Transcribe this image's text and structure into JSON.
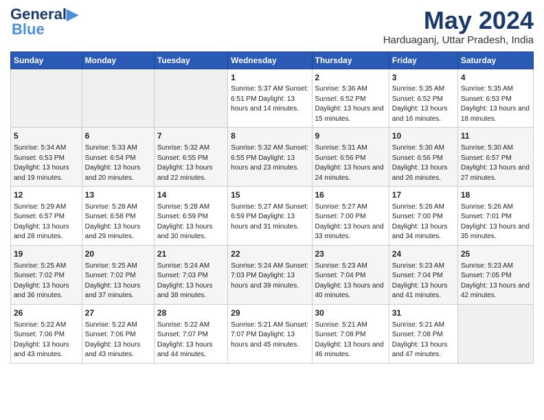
{
  "header": {
    "logo_line1": "General",
    "logo_line2": "Blue",
    "month_title": "May 2024",
    "location": "Harduaganj, Uttar Pradesh, India"
  },
  "days_of_week": [
    "Sunday",
    "Monday",
    "Tuesday",
    "Wednesday",
    "Thursday",
    "Friday",
    "Saturday"
  ],
  "weeks": [
    [
      {
        "day": "",
        "info": ""
      },
      {
        "day": "",
        "info": ""
      },
      {
        "day": "",
        "info": ""
      },
      {
        "day": "1",
        "info": "Sunrise: 5:37 AM\nSunset: 6:51 PM\nDaylight: 13 hours\nand 14 minutes."
      },
      {
        "day": "2",
        "info": "Sunrise: 5:36 AM\nSunset: 6:52 PM\nDaylight: 13 hours\nand 15 minutes."
      },
      {
        "day": "3",
        "info": "Sunrise: 5:35 AM\nSunset: 6:52 PM\nDaylight: 13 hours\nand 16 minutes."
      },
      {
        "day": "4",
        "info": "Sunrise: 5:35 AM\nSunset: 6:53 PM\nDaylight: 13 hours\nand 18 minutes."
      }
    ],
    [
      {
        "day": "5",
        "info": "Sunrise: 5:34 AM\nSunset: 6:53 PM\nDaylight: 13 hours\nand 19 minutes."
      },
      {
        "day": "6",
        "info": "Sunrise: 5:33 AM\nSunset: 6:54 PM\nDaylight: 13 hours\nand 20 minutes."
      },
      {
        "day": "7",
        "info": "Sunrise: 5:32 AM\nSunset: 6:55 PM\nDaylight: 13 hours\nand 22 minutes."
      },
      {
        "day": "8",
        "info": "Sunrise: 5:32 AM\nSunset: 6:55 PM\nDaylight: 13 hours\nand 23 minutes."
      },
      {
        "day": "9",
        "info": "Sunrise: 5:31 AM\nSunset: 6:56 PM\nDaylight: 13 hours\nand 24 minutes."
      },
      {
        "day": "10",
        "info": "Sunrise: 5:30 AM\nSunset: 6:56 PM\nDaylight: 13 hours\nand 26 minutes."
      },
      {
        "day": "11",
        "info": "Sunrise: 5:30 AM\nSunset: 6:57 PM\nDaylight: 13 hours\nand 27 minutes."
      }
    ],
    [
      {
        "day": "12",
        "info": "Sunrise: 5:29 AM\nSunset: 6:57 PM\nDaylight: 13 hours\nand 28 minutes."
      },
      {
        "day": "13",
        "info": "Sunrise: 5:28 AM\nSunset: 6:58 PM\nDaylight: 13 hours\nand 29 minutes."
      },
      {
        "day": "14",
        "info": "Sunrise: 5:28 AM\nSunset: 6:59 PM\nDaylight: 13 hours\nand 30 minutes."
      },
      {
        "day": "15",
        "info": "Sunrise: 5:27 AM\nSunset: 6:59 PM\nDaylight: 13 hours\nand 31 minutes."
      },
      {
        "day": "16",
        "info": "Sunrise: 5:27 AM\nSunset: 7:00 PM\nDaylight: 13 hours\nand 33 minutes."
      },
      {
        "day": "17",
        "info": "Sunrise: 5:26 AM\nSunset: 7:00 PM\nDaylight: 13 hours\nand 34 minutes."
      },
      {
        "day": "18",
        "info": "Sunrise: 5:26 AM\nSunset: 7:01 PM\nDaylight: 13 hours\nand 35 minutes."
      }
    ],
    [
      {
        "day": "19",
        "info": "Sunrise: 5:25 AM\nSunset: 7:02 PM\nDaylight: 13 hours\nand 36 minutes."
      },
      {
        "day": "20",
        "info": "Sunrise: 5:25 AM\nSunset: 7:02 PM\nDaylight: 13 hours\nand 37 minutes."
      },
      {
        "day": "21",
        "info": "Sunrise: 5:24 AM\nSunset: 7:03 PM\nDaylight: 13 hours\nand 38 minutes."
      },
      {
        "day": "22",
        "info": "Sunrise: 5:24 AM\nSunset: 7:03 PM\nDaylight: 13 hours\nand 39 minutes."
      },
      {
        "day": "23",
        "info": "Sunrise: 5:23 AM\nSunset: 7:04 PM\nDaylight: 13 hours\nand 40 minutes."
      },
      {
        "day": "24",
        "info": "Sunrise: 5:23 AM\nSunset: 7:04 PM\nDaylight: 13 hours\nand 41 minutes."
      },
      {
        "day": "25",
        "info": "Sunrise: 5:23 AM\nSunset: 7:05 PM\nDaylight: 13 hours\nand 42 minutes."
      }
    ],
    [
      {
        "day": "26",
        "info": "Sunrise: 5:22 AM\nSunset: 7:06 PM\nDaylight: 13 hours\nand 43 minutes."
      },
      {
        "day": "27",
        "info": "Sunrise: 5:22 AM\nSunset: 7:06 PM\nDaylight: 13 hours\nand 43 minutes."
      },
      {
        "day": "28",
        "info": "Sunrise: 5:22 AM\nSunset: 7:07 PM\nDaylight: 13 hours\nand 44 minutes."
      },
      {
        "day": "29",
        "info": "Sunrise: 5:21 AM\nSunset: 7:07 PM\nDaylight: 13 hours\nand 45 minutes."
      },
      {
        "day": "30",
        "info": "Sunrise: 5:21 AM\nSunset: 7:08 PM\nDaylight: 13 hours\nand 46 minutes."
      },
      {
        "day": "31",
        "info": "Sunrise: 5:21 AM\nSunset: 7:08 PM\nDaylight: 13 hours\nand 47 minutes."
      },
      {
        "day": "",
        "info": ""
      }
    ]
  ]
}
